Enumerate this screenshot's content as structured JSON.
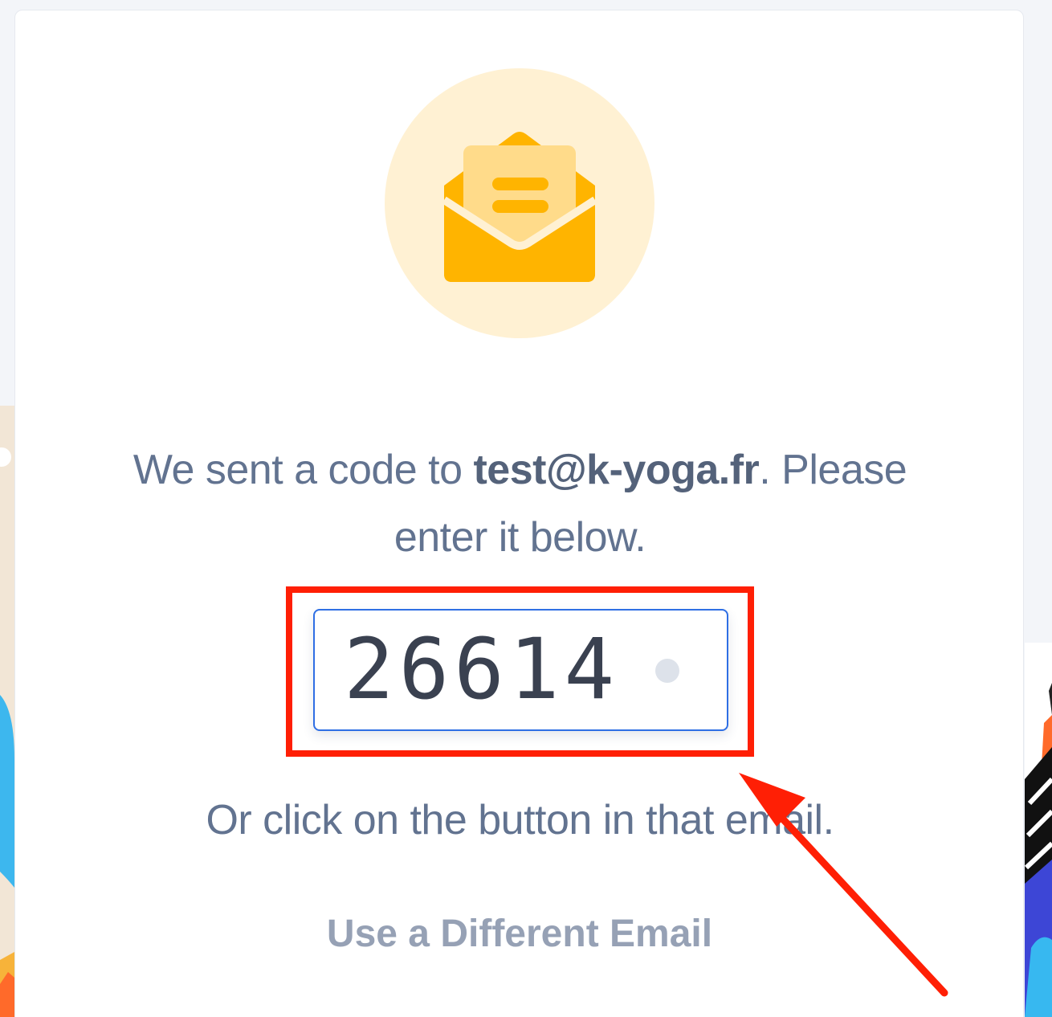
{
  "verification": {
    "message_prefix": "We sent a code to ",
    "email": "test@k-yoga.fr",
    "message_suffix": ". Please enter it below.",
    "code_value": "26614",
    "alt_instruction": "Or click on the button in that email.",
    "different_email_label": "Use a Different Email"
  },
  "icons": {
    "envelope": "open-envelope-icon"
  },
  "colors": {
    "accent": "#ffb400",
    "icon_bg": "#fff1d3",
    "text": "#627390",
    "input_border": "#2f6fe4",
    "annotation": "#ff1f05"
  }
}
